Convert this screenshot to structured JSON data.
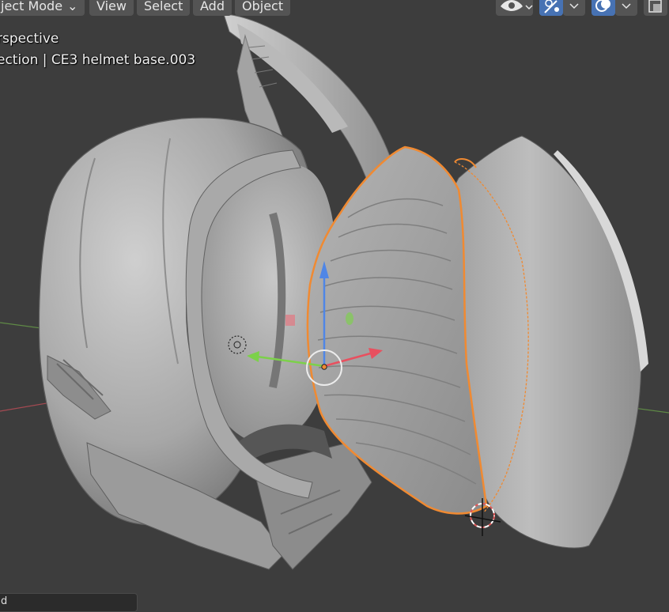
{
  "header": {
    "mode_label": "ject Mode",
    "menus": [
      "View",
      "Select",
      "Add",
      "Object"
    ]
  },
  "overlay": {
    "view_name": "rspective",
    "collection_info": "ection | CE3 helmet base.003"
  },
  "bottom_panel": {
    "label": "d"
  },
  "icons": {
    "mode_dropdown": "chevron-down-icon",
    "visibility": "eye-icon",
    "gizmo": "gizmo-icon",
    "overlays": "overlays-icon",
    "xray": "xray-icon",
    "origin": "origin-icon",
    "cursor": "3d-cursor-icon"
  },
  "colors": {
    "background": "#3d3d3d",
    "header_button": "#545454",
    "active_toggle": "#4772b3",
    "selection_outline": "#f08a32",
    "axis_x": "#e8505f",
    "axis_y": "#7cd14a",
    "axis_z": "#4f86e6"
  }
}
